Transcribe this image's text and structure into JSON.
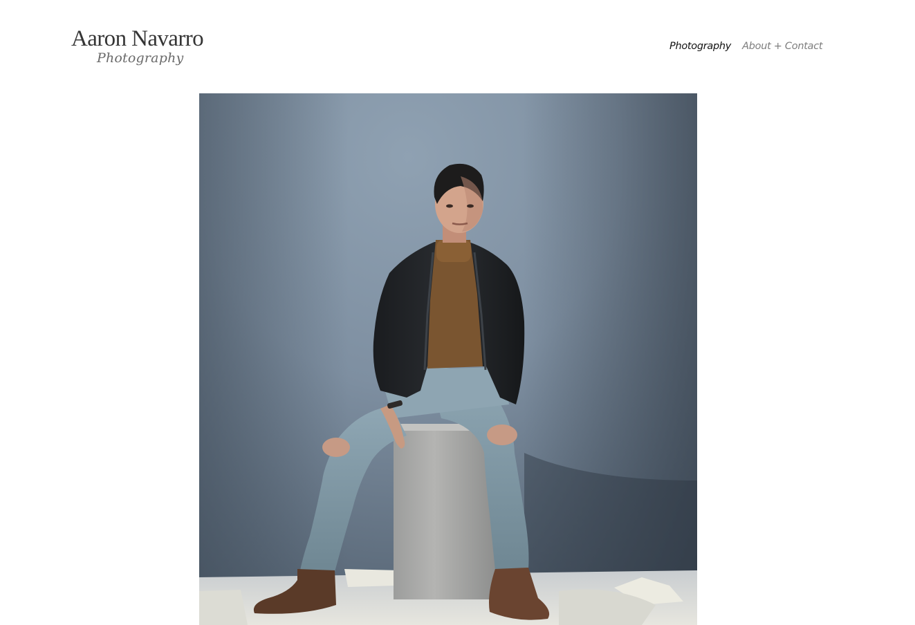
{
  "site": {
    "name": "Aaron Navarro",
    "tagline": "Photography"
  },
  "nav": {
    "items": [
      {
        "label": "Photography",
        "active": true
      },
      {
        "label": "About + Contact",
        "active": false
      }
    ]
  },
  "gallery": {
    "photo_subject": "portrait-man-seated-on-concrete-block"
  }
}
